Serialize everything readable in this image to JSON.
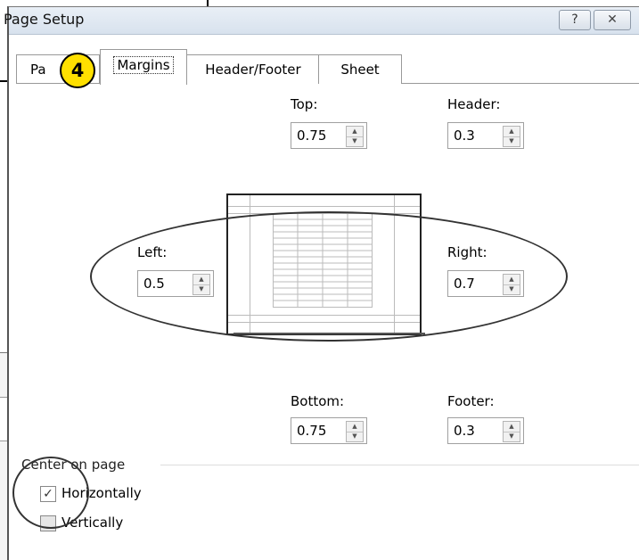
{
  "dialog": {
    "title": "Page Setup",
    "help_label": "?",
    "close_label": "✕"
  },
  "tabs": [
    {
      "label": "Pa"
    },
    {
      "label": "Margins"
    },
    {
      "label": "Header/Footer"
    },
    {
      "label": "Sheet"
    }
  ],
  "step_badge": "4",
  "margins": {
    "top": {
      "label": "Top:",
      "value": "0.75"
    },
    "header": {
      "label": "Header:",
      "value": "0.3"
    },
    "left": {
      "label": "Left:",
      "value": "0.5"
    },
    "right": {
      "label": "Right:",
      "value": "0.7"
    },
    "bottom": {
      "label": "Bottom:",
      "value": "0.75"
    },
    "footer": {
      "label": "Footer:",
      "value": "0.3"
    }
  },
  "center_on_page": {
    "label": "Center on page",
    "horizontally": {
      "label": "Horizontally",
      "checked": true
    },
    "vertically": {
      "label": "Vertically",
      "checked": false
    }
  },
  "icons": {
    "spin_up": "up-arrow-icon",
    "spin_down": "down-arrow-icon",
    "check": "checkmark-icon"
  },
  "colors": {
    "badge": "#ffe000",
    "titlebar": "#dce5ef"
  }
}
